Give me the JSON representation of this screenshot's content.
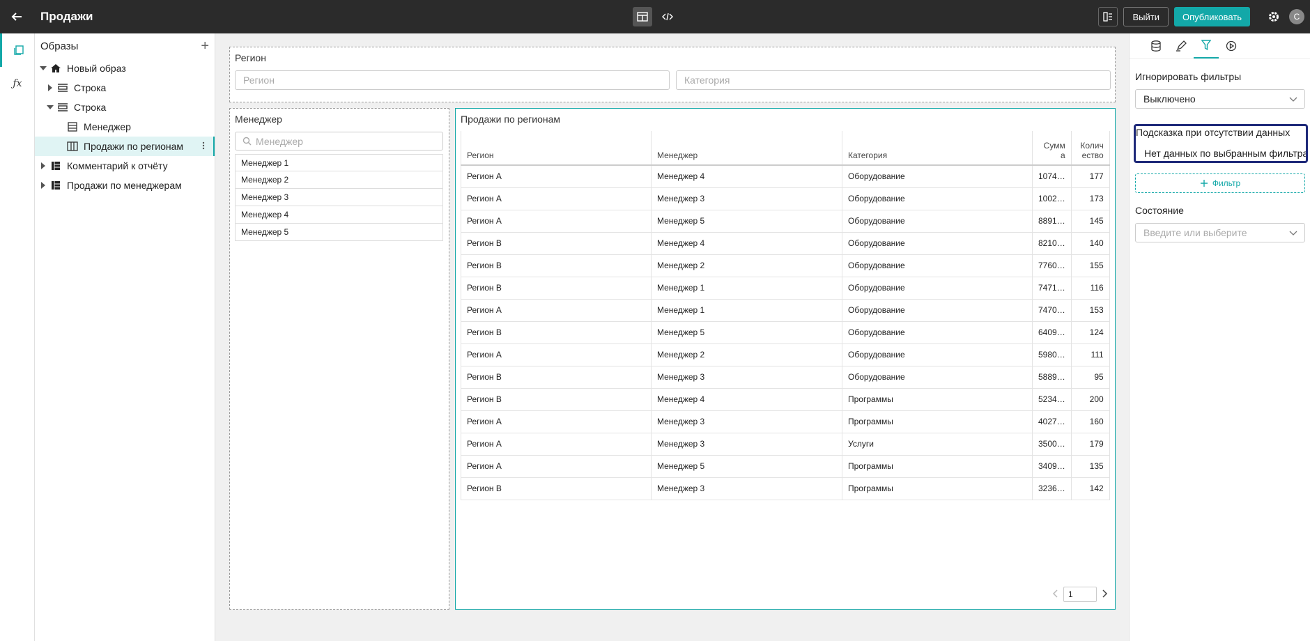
{
  "header": {
    "title": "Продажи",
    "logout_label": "Выйти",
    "publish_label": "Опубликовать",
    "avatar_letter": "С"
  },
  "tree": {
    "title": "Образы",
    "nodes": [
      {
        "label": "Новый образ",
        "icon": "home-icon"
      },
      {
        "label": "Строка",
        "icon": "row-icon"
      },
      {
        "label": "Строка",
        "icon": "row-icon"
      },
      {
        "label": "Менеджер",
        "icon": "list-icon"
      },
      {
        "label": "Продажи по регионам",
        "icon": "table-icon"
      },
      {
        "label": "Комментарий к отчёту",
        "icon": "block-icon"
      },
      {
        "label": "Продажи по менеджерам",
        "icon": "block-icon"
      }
    ]
  },
  "filters_box": {
    "label": "Регион",
    "region_placeholder": "Регион",
    "category_placeholder": "Категория"
  },
  "manager_box": {
    "label": "Менеджер",
    "search_placeholder": "Менеджер",
    "items": [
      "Менеджер 1",
      "Менеджер 2",
      "Менеджер 3",
      "Менеджер 4",
      "Менеджер 5"
    ]
  },
  "grid_box": {
    "title": "Продажи по регионам",
    "columns": [
      "Регион",
      "Менеджер",
      "Категория",
      "Сумм а",
      "Колич ество"
    ],
    "rows": [
      [
        "Регион A",
        "Менеджер 4",
        "Оборудование",
        "1074…",
        "177"
      ],
      [
        "Регион A",
        "Менеджер 3",
        "Оборудование",
        "1002…",
        "173"
      ],
      [
        "Регион A",
        "Менеджер 5",
        "Оборудование",
        "8891…",
        "145"
      ],
      [
        "Регион B",
        "Менеджер 4",
        "Оборудование",
        "8210…",
        "140"
      ],
      [
        "Регион B",
        "Менеджер 2",
        "Оборудование",
        "7760…",
        "155"
      ],
      [
        "Регион B",
        "Менеджер 1",
        "Оборудование",
        "7471…",
        "116"
      ],
      [
        "Регион A",
        "Менеджер 1",
        "Оборудование",
        "7470…",
        "153"
      ],
      [
        "Регион B",
        "Менеджер 5",
        "Оборудование",
        "6409…",
        "124"
      ],
      [
        "Регион A",
        "Менеджер 2",
        "Оборудование",
        "5980…",
        "111"
      ],
      [
        "Регион B",
        "Менеджер 3",
        "Оборудование",
        "5889…",
        "95"
      ],
      [
        "Регион B",
        "Менеджер 4",
        "Программы",
        "5234…",
        "200"
      ],
      [
        "Регион A",
        "Менеджер 3",
        "Программы",
        "4027…",
        "160"
      ],
      [
        "Регион A",
        "Менеджер 3",
        "Услуги",
        "3500…",
        "179"
      ],
      [
        "Регион A",
        "Менеджер 5",
        "Программы",
        "3409…",
        "135"
      ],
      [
        "Регион B",
        "Менеджер 3",
        "Программы",
        "3236…",
        "142"
      ]
    ],
    "page": "1"
  },
  "props": {
    "ignore_filters_label": "Игнорировать фильтры",
    "ignore_filters_value": "Выключено",
    "no_data_hint_label": "Подсказка при отсутствии данных",
    "no_data_hint_value": "Нет данных по выбранным фильтрам",
    "add_filter_label": "Фильтр",
    "state_label": "Состояние",
    "state_placeholder": "Введите или выберите"
  },
  "colors": {
    "accent": "#13a8a8",
    "topbar": "#2b2b2b",
    "focus": "#1f2a7a"
  }
}
